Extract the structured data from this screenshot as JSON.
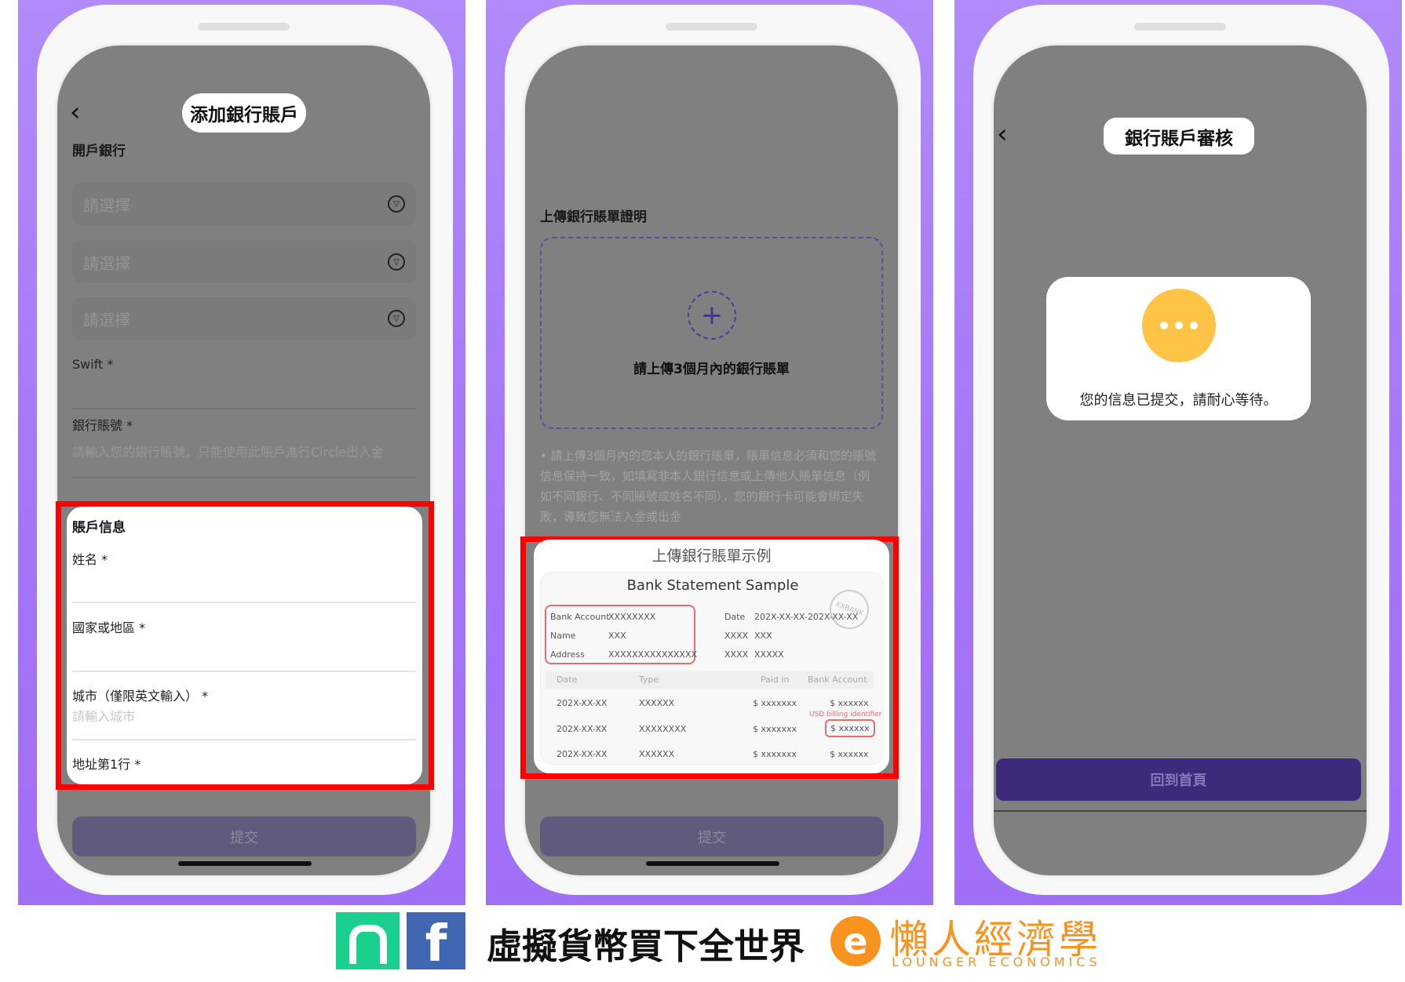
{
  "panel1": {
    "title": "添加銀行賬戶",
    "bank_section_label": "開戶銀行",
    "selects": [
      {
        "placeholder": "請選擇"
      },
      {
        "placeholder": "請選擇"
      },
      {
        "placeholder": "請選擇"
      }
    ],
    "swift_label": "Swift *",
    "account_label": "銀行賬號 *",
    "account_placeholder": "請輸入您的銀行賬號，只能使用此賬戶進行Circle出入金",
    "info_section_label": "賬戶信息",
    "name_label": "姓名 *",
    "country_label": "國家或地區 *",
    "city_label": "城市（僅限英文輸入） *",
    "city_placeholder": "請輸入城市",
    "address_label": "地址第1行 *",
    "submit_label": "提交"
  },
  "panel2": {
    "upload_label": "上傳銀行賬單證明",
    "upload_hint": "請上傳3個月內的銀行賬單",
    "note_lines": [
      "• 請上傳3個月內的您本人的銀行賬單，賬單信息必須和您的賬號",
      "信息保持一致，如填寫非本人銀行信息或上傳他人賬單信息（例",
      "如不同銀行、不同賬號或姓名不同），您的銀行卡可能會綁定失",
      "敗，導致您無法入金或出金"
    ],
    "sample_title": "上傳銀行賬單示例",
    "sample": {
      "heading": "Bank Statement Sample",
      "stamp": "XXBANK",
      "left_fields": [
        {
          "k": "Bank Account",
          "v": "XXXXXXXX"
        },
        {
          "k": "Name",
          "v": "XXX"
        },
        {
          "k": "Address",
          "v": "XXXXXXXXXXXXXXX"
        }
      ],
      "right_fields": [
        {
          "k": "Date",
          "v": "202X-XX-XX-202X-XX-XX"
        },
        {
          "k": "XXXX",
          "v": "XXX"
        },
        {
          "k": "XXXX",
          "v": "XXXXX"
        }
      ],
      "columns": [
        "Date",
        "Type",
        "Paid in",
        "Bank Account"
      ],
      "rows": [
        [
          "202X-XX-XX",
          "XXXXXX",
          "$ xxxxxxx",
          "$ xxxxxx"
        ],
        [
          "202X-XX-XX",
          "XXXXXXXX",
          "$ xxxxxxx",
          "$ xxxxxx"
        ],
        [
          "202X-XX-XX",
          "XXXXXX",
          "$ xxxxxxx",
          "$ xxxxxx"
        ]
      ],
      "annotation": "USD billing identifier"
    },
    "submit_label": "提交"
  },
  "panel3": {
    "title": "銀行賬戶審核",
    "message": "您的信息已提交，請耐心等待。",
    "home_button": "回到首頁"
  },
  "footer": {
    "slogan": "虛擬貨幣買下全世界",
    "brand_cn": "懶人經濟學",
    "brand_en": "LOUNGER ECONOMICS"
  },
  "colors": {
    "accent": "#3d2a7a",
    "highlight": "#ff0000",
    "pending": "#ffc445",
    "panel_bg": "#a474f7",
    "brand": "#f7931e"
  },
  "icons": [
    "chevron-left-icon",
    "dropdown-circle-icon",
    "plus-icon",
    "more-dots-icon",
    "app-logo-icon",
    "facebook-icon",
    "brand-logo-icon"
  ]
}
